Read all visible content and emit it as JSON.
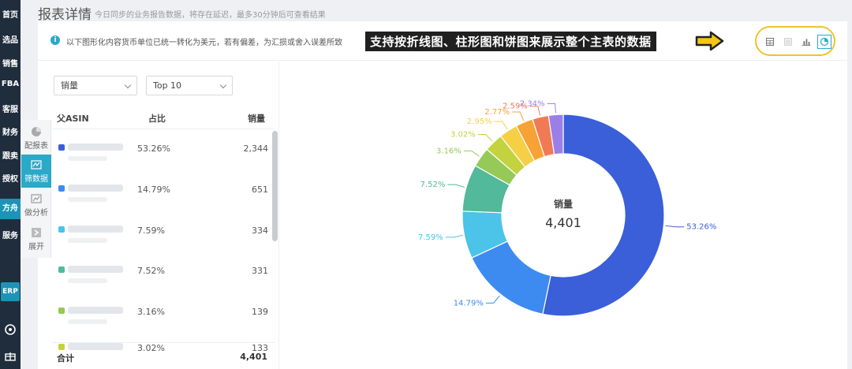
{
  "nav": {
    "items": [
      "首页",
      "选品",
      "销售",
      "FBA",
      "客服",
      "财务",
      "跟卖",
      "授权",
      "方舟",
      "服务"
    ],
    "erp": "ERP"
  },
  "tools": [
    {
      "label": "配报表",
      "icon": "pie-icon"
    },
    {
      "label": "筛数据",
      "icon": "filter-data-icon"
    },
    {
      "label": "做分析",
      "icon": "analysis-icon"
    },
    {
      "label": "展开",
      "icon": "expand-icon"
    }
  ],
  "header": {
    "title": "报表详情",
    "subtitle": "今日同步的业务报告数据，将存在延迟，最多30分钟后可查看结果"
  },
  "info": {
    "text": "以下图形化内容货币单位已统一转化为美元，若有偏差，为汇损或舍入误差所致",
    "callout": "支持按折线图、柱形图和饼图来展示整个主表的数据"
  },
  "view_buttons": [
    "table-view-icon",
    "list-view-icon",
    "bar-chart-icon",
    "pie-chart-icon"
  ],
  "filters": {
    "metric": "销量",
    "top": "Top 10"
  },
  "table": {
    "headers": [
      "父ASIN",
      "占比",
      "销量"
    ],
    "rows": [
      {
        "pct": "53.26%",
        "value": "2,344",
        "color": "#3a5fd8"
      },
      {
        "pct": "14.79%",
        "value": "651",
        "color": "#3d8bf0"
      },
      {
        "pct": "7.59%",
        "value": "334",
        "color": "#4cc3e8"
      },
      {
        "pct": "7.52%",
        "value": "331",
        "color": "#52b99a"
      },
      {
        "pct": "3.16%",
        "value": "139",
        "color": "#95c958"
      },
      {
        "pct": "3.02%",
        "value": "133",
        "color": "#c3d33f"
      }
    ],
    "total_label": "合计",
    "total_value": "4,401"
  },
  "chart_data": {
    "type": "pie",
    "center_label": "销量",
    "center_value": "4,401",
    "slices": [
      {
        "label": "53.26%",
        "value": 53.26,
        "color": "#3a5fd8"
      },
      {
        "label": "14.79%",
        "value": 14.79,
        "color": "#3d8bf0"
      },
      {
        "label": "7.59%",
        "value": 7.59,
        "color": "#4cc3e8"
      },
      {
        "label": "7.52%",
        "value": 7.52,
        "color": "#52b99a"
      },
      {
        "label": "3.16%",
        "value": 3.16,
        "color": "#95c958"
      },
      {
        "label": "3.02%",
        "value": 3.02,
        "color": "#c3d33f"
      },
      {
        "label": "2.95%",
        "value": 2.95,
        "color": "#f5cf45"
      },
      {
        "label": "2.77%",
        "value": 2.77,
        "color": "#f7a234"
      },
      {
        "label": "2.59%",
        "value": 2.59,
        "color": "#f07a53"
      },
      {
        "label": "2.34%",
        "value": 2.34,
        "color": "#9b7fe6"
      }
    ]
  }
}
